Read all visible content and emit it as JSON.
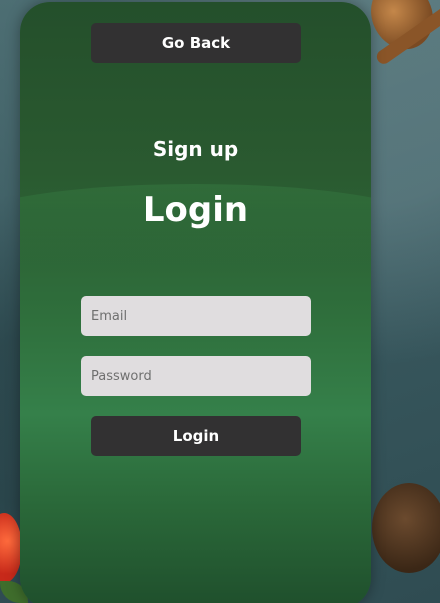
{
  "header": {
    "go_back_label": "Go Back"
  },
  "form": {
    "signup_link": "Sign up",
    "title": "Login",
    "email_placeholder": "Email",
    "password_placeholder": "Password",
    "submit_label": "Login"
  },
  "colors": {
    "card_green": "#2f6f3c",
    "button_dark": "#323132",
    "input_bg": "#e0dddf"
  }
}
